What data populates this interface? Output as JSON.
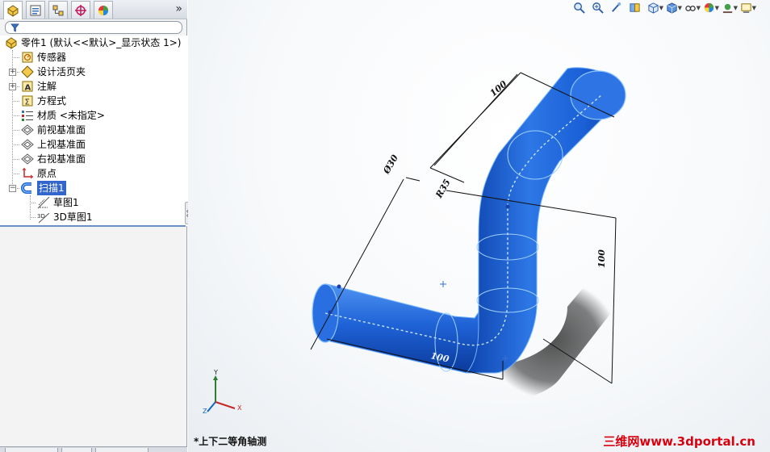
{
  "feature_manager": {
    "collapse_glyph": "»",
    "tabs": [
      {
        "name": "featuremanager-tab",
        "icon": "feature-tree-icon"
      },
      {
        "name": "propertymanager-tab",
        "icon": "property-icon"
      },
      {
        "name": "configurationmanager-tab",
        "icon": "configuration-icon"
      },
      {
        "name": "dimxpert-tab",
        "icon": "dimxpert-icon"
      },
      {
        "name": "display-manager-tab",
        "icon": "appearance-icon"
      }
    ],
    "tree": {
      "root_label": "零件1  (默认<<默认>_显示状态 1>)",
      "items": [
        {
          "label": "传感器",
          "icon": "sensor-icon",
          "expandable": false
        },
        {
          "label": "设计活页夹",
          "icon": "design-binder-icon",
          "expandable": true
        },
        {
          "label": "注解",
          "icon": "annotation-icon",
          "expandable": true
        },
        {
          "label": "方程式",
          "icon": "equation-icon",
          "expandable": false
        },
        {
          "label": "材质 <未指定>",
          "icon": "material-icon",
          "expandable": false
        },
        {
          "label": "前视基准面",
          "icon": "plane-icon",
          "expandable": false
        },
        {
          "label": "上视基准面",
          "icon": "plane-icon",
          "expandable": false
        },
        {
          "label": "右视基准面",
          "icon": "plane-icon",
          "expandable": false
        },
        {
          "label": "原点",
          "icon": "origin-icon",
          "expandable": false
        },
        {
          "label": "扫描1",
          "icon": "sweep-icon",
          "expandable": true,
          "selected": true
        },
        {
          "label": "草图1",
          "icon": "sketch-icon",
          "child": true
        },
        {
          "label": "3D草图1",
          "icon": "3d-sketch-icon",
          "child": true
        }
      ]
    }
  },
  "viewport": {
    "view_name": "*上下二等角轴测",
    "dimensions": [
      "100",
      "Ø30",
      "R35",
      "100",
      "100"
    ],
    "triad": {
      "x": "X",
      "y": "Y",
      "z": "Z"
    },
    "watermark": "三维网www.3dportal.cn",
    "toolbar_icons": [
      "zoom-to-fit-icon",
      "zoom-to-area-icon",
      "previous-view-icon",
      "section-view-icon",
      "view-orientation-icon",
      "display-style-icon",
      "hide-show-items-icon",
      "edit-appearance-icon",
      "apply-scene-icon",
      "view-settings-icon"
    ]
  },
  "colors": {
    "part_body": "#1a5fd6",
    "part_edge": "#6fb1ff",
    "selection": "#3366cc",
    "watermark": "#d8000f"
  }
}
